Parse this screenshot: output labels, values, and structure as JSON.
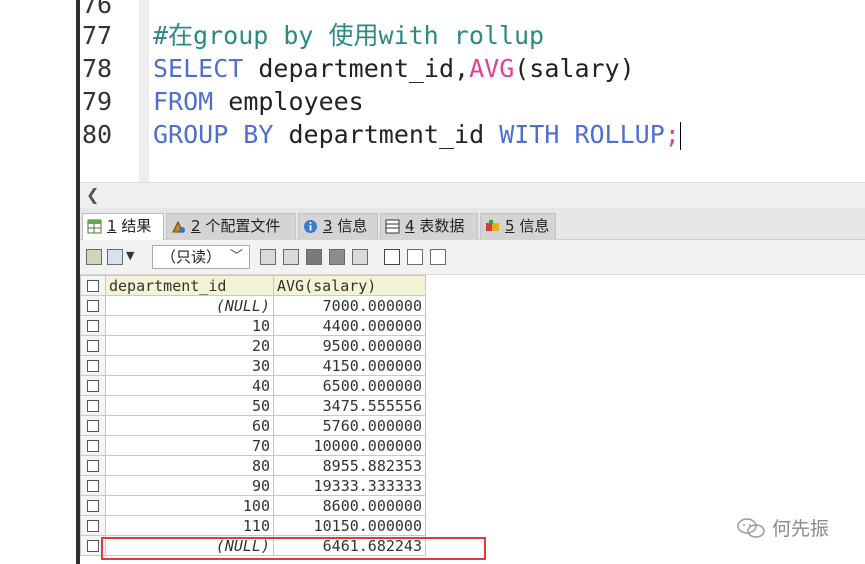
{
  "editor": {
    "line_numbers": [
      "76",
      "77",
      "78",
      "79",
      "80"
    ],
    "comment": "#在group by 使用with rollup",
    "line78": {
      "select_kw": "SELECT",
      "col": " department_id,",
      "fn": "AVG",
      "arg": "(salary)"
    },
    "line79": {
      "from_kw": "FROM",
      "table": " employees"
    },
    "line80": {
      "group_kw": "GROUP BY",
      "col": " department_id ",
      "with_kw": "WITH ROLLUP",
      "semi": ";"
    }
  },
  "tabs": [
    {
      "num": "1",
      "label": " 结果",
      "icon": "grid-icon",
      "active": true
    },
    {
      "num": "2",
      "label": " 个配置文件",
      "icon": "profile-icon",
      "active": false
    },
    {
      "num": "3",
      "label": " 信息",
      "icon": "info-icon",
      "active": false
    },
    {
      "num": "4",
      "label": " 表数据",
      "icon": "table-data-icon",
      "active": false
    },
    {
      "num": "5",
      "label": " 信息",
      "icon": "info-icon",
      "active": false
    }
  ],
  "toolbar": {
    "readonly_value": "（只读）",
    "dropdown_arrow": "﹀"
  },
  "grid": {
    "headers": [
      "department_id",
      "AVG(salary)"
    ],
    "rows": [
      [
        "(NULL)",
        "7000.000000"
      ],
      [
        "10",
        "4400.000000"
      ],
      [
        "20",
        "9500.000000"
      ],
      [
        "30",
        "4150.000000"
      ],
      [
        "40",
        "6500.000000"
      ],
      [
        "50",
        "3475.555556"
      ],
      [
        "60",
        "5760.000000"
      ],
      [
        "70",
        "10000.000000"
      ],
      [
        "80",
        "8955.882353"
      ],
      [
        "90",
        "19333.333333"
      ],
      [
        "100",
        "8600.000000"
      ],
      [
        "110",
        "10150.000000"
      ],
      [
        "(NULL)",
        "6461.682243"
      ]
    ]
  },
  "watermark": {
    "text": "何先振"
  },
  "colors": {
    "keyword": "#4e6fd0",
    "function": "#e0409a",
    "comment": "#2b8a82",
    "highlight": "#e03a3a"
  }
}
